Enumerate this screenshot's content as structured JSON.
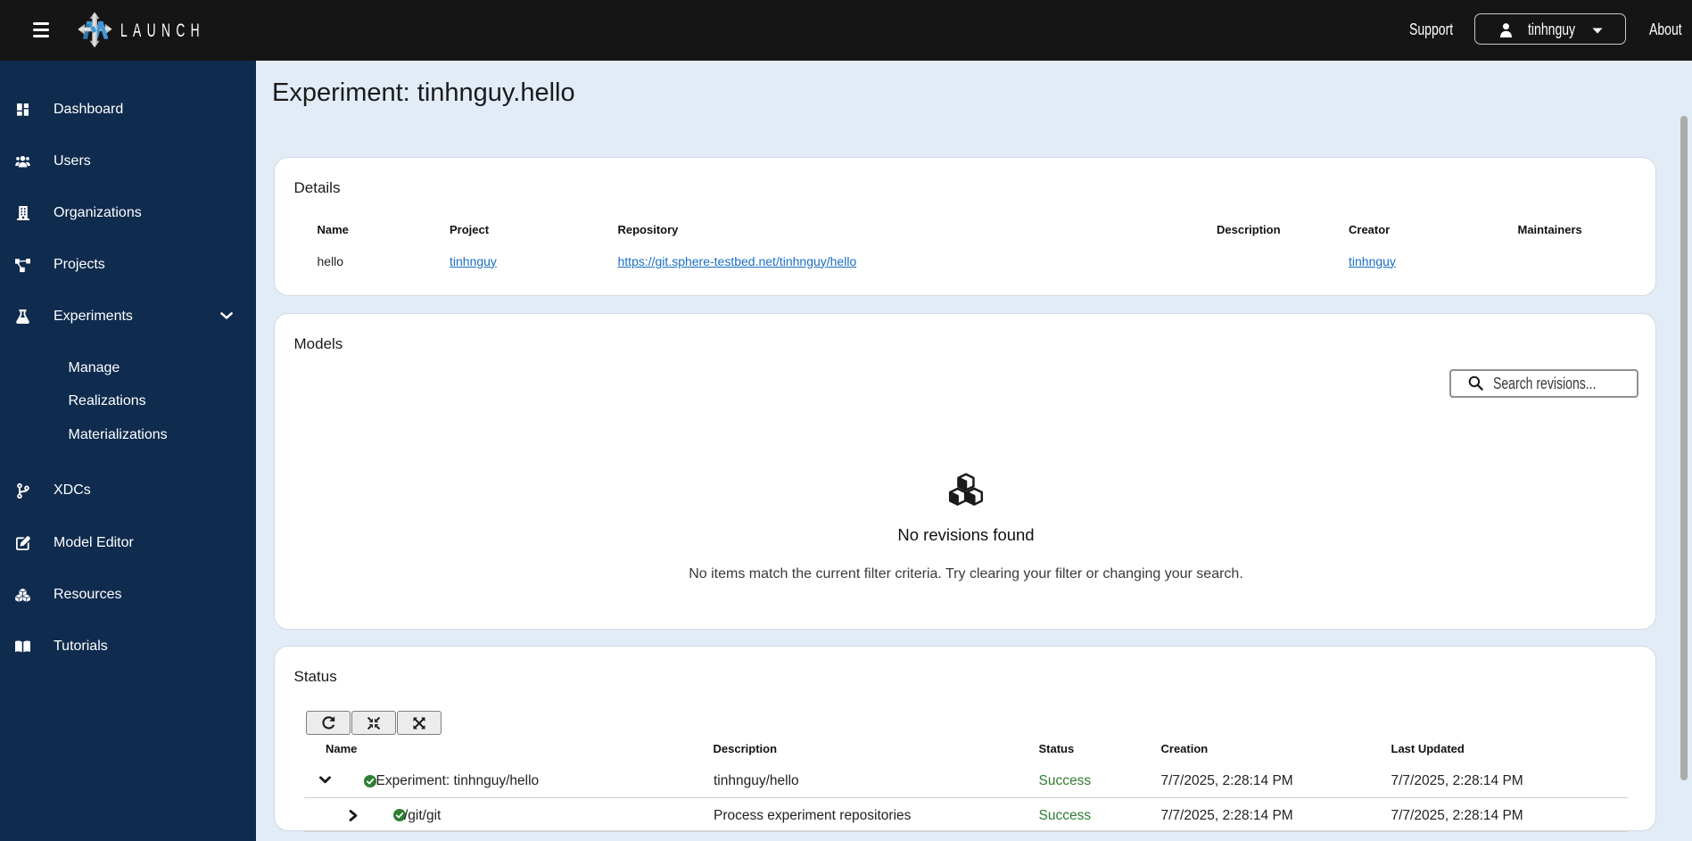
{
  "header": {
    "brand": "LAUNCH",
    "support_label": "Support",
    "username": "tinhnguy",
    "about_label": "About"
  },
  "sidebar": {
    "items": [
      {
        "label": "Dashboard",
        "icon": "dashboard"
      },
      {
        "label": "Users",
        "icon": "users"
      },
      {
        "label": "Organizations",
        "icon": "building"
      },
      {
        "label": "Projects",
        "icon": "sitemap"
      },
      {
        "label": "Experiments",
        "icon": "flask",
        "expanded": true
      },
      {
        "label": "XDCs",
        "icon": "code-branch"
      },
      {
        "label": "Model Editor",
        "icon": "edit"
      },
      {
        "label": "Resources",
        "icon": "cubes"
      },
      {
        "label": "Tutorials",
        "icon": "book-open"
      }
    ],
    "experiments_children": [
      {
        "label": "Manage"
      },
      {
        "label": "Realizations"
      },
      {
        "label": "Materializations"
      }
    ]
  },
  "page": {
    "title": "Experiment: tinhnguy.hello"
  },
  "details": {
    "title": "Details",
    "columns": [
      "Name",
      "Project",
      "Repository",
      "Description",
      "Creator",
      "Maintainers"
    ],
    "row": {
      "name": "hello",
      "project": "tinhnguy",
      "repository": "https://git.sphere-testbed.net/tinhnguy/hello",
      "description": "",
      "creator": "tinhnguy",
      "maintainers": ""
    }
  },
  "models": {
    "title": "Models",
    "search_placeholder": "Search revisions...",
    "empty_title": "No revisions found",
    "empty_message": "No items match the current filter criteria. Try clearing your filter or changing your search."
  },
  "status": {
    "title": "Status",
    "columns": [
      "Name",
      "Description",
      "Status",
      "Creation",
      "Last Updated"
    ],
    "rows": [
      {
        "name": "Experiment: tinhnguy/hello",
        "description": "tinhnguy/hello",
        "status": "Success",
        "creation": "7/7/2025, 2:28:14 PM",
        "last_updated": "7/7/2025, 2:28:14 PM"
      },
      {
        "name": "/git/git",
        "description": "Process experiment repositories",
        "status": "Success",
        "creation": "7/7/2025, 2:28:14 PM",
        "last_updated": "7/7/2025, 2:28:14 PM"
      }
    ]
  },
  "colors": {
    "topbar": "#151515",
    "sidebar": "#0f2b4e",
    "background": "#e2ecf7",
    "link": "#1b6ec2",
    "success": "#2e7d32",
    "logo_blue": "#3e96d2"
  }
}
